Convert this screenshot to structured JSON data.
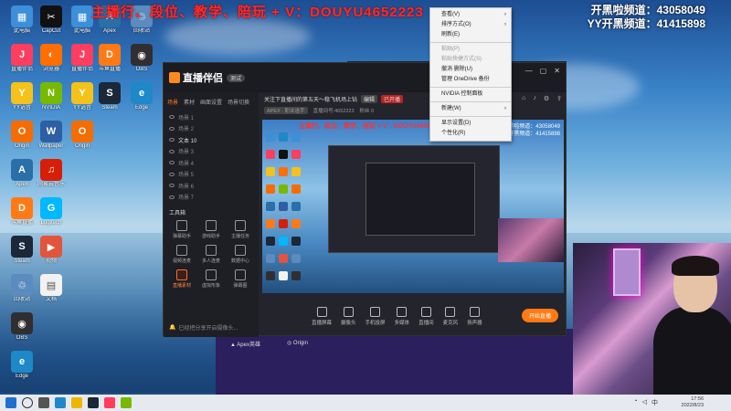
{
  "overlay": {
    "red_text": "主播行、段位、教学、陪玩 + V：DOUYU4652223",
    "line1": "开黑啦频道：43058049",
    "line2": "YY开黑频道：41415898"
  },
  "desktop_icons": [
    {
      "label": "此电脑",
      "color": "#3c8fd9",
      "glyph": "▦"
    },
    {
      "label": "直播伴侣",
      "color": "#ff3d5e",
      "glyph": "J"
    },
    {
      "label": "YY语音",
      "color": "#f4c21a",
      "glyph": "Y"
    },
    {
      "label": "Origin",
      "color": "#f56c00",
      "glyph": "O"
    },
    {
      "label": "Apex",
      "color": "#2a6fa8",
      "glyph": "A"
    },
    {
      "label": "斗鱼直播",
      "color": "#ff7a14",
      "glyph": "D"
    },
    {
      "label": "Steam",
      "color": "#1b2838",
      "glyph": "S"
    },
    {
      "label": "回收站",
      "color": "#5b8bbf",
      "glyph": "♲"
    },
    {
      "label": "OBS",
      "color": "#302e31",
      "glyph": "◉"
    },
    {
      "label": "Edge",
      "color": "#1e88c8",
      "glyph": "e"
    },
    {
      "label": "CapCut",
      "color": "#111",
      "glyph": "✂"
    },
    {
      "label": "浏览器",
      "color": "#ff6f00",
      "glyph": "◐"
    },
    {
      "label": "NVIDIA",
      "color": "#76b900",
      "glyph": "N"
    },
    {
      "label": "Wallpaper",
      "color": "#2e5fa3",
      "glyph": "W"
    },
    {
      "label": "网易云音乐",
      "color": "#d81e06",
      "glyph": "♫"
    },
    {
      "label": "Logitech",
      "color": "#00b8fc",
      "glyph": "G"
    },
    {
      "label": "视频",
      "color": "#e2543c",
      "glyph": "▶"
    },
    {
      "label": "文档",
      "color": "#f2f2f2",
      "glyph": "▤"
    }
  ],
  "context_menu": [
    {
      "label": "查看(V)",
      "arrow": true,
      "disabled": false
    },
    {
      "label": "排序方式(O)",
      "arrow": true,
      "disabled": false
    },
    {
      "label": "刷新(E)",
      "arrow": false,
      "disabled": false
    },
    {
      "sep": true
    },
    {
      "label": "粘贴(P)",
      "arrow": false,
      "disabled": true
    },
    {
      "label": "粘贴快捷方式(S)",
      "arrow": false,
      "disabled": true
    },
    {
      "label": "撤消 删除(U)",
      "arrow": false,
      "disabled": false
    },
    {
      "label": "管理 OneDrive 备份",
      "arrow": false,
      "disabled": false
    },
    {
      "sep": true
    },
    {
      "label": "NVIDIA 控制面板",
      "arrow": false,
      "disabled": false
    },
    {
      "sep": true
    },
    {
      "label": "新建(W)",
      "arrow": true,
      "disabled": false
    },
    {
      "sep": true
    },
    {
      "label": "显示设置(D)",
      "arrow": false,
      "disabled": false
    },
    {
      "label": "个性化(R)",
      "arrow": false,
      "disabled": false
    }
  ],
  "app": {
    "name": "直播伴侣",
    "version": "测试",
    "tabs": [
      "场景",
      "素材",
      "画面设置",
      "场景切换"
    ],
    "active_tab": 0,
    "scenes": [
      "场景 1",
      "场景 2",
      "文本 10",
      "场景 3",
      "场景 4",
      "场景 5",
      "场景 6",
      "场景 7"
    ],
    "selected_scene": 2,
    "tools_title": "工具箱",
    "tools": [
      "弹幕助手",
      "游戏助手",
      "主播任务",
      "视频连麦",
      "多人连麦",
      "数据中心",
      "直播素材",
      "虚拟形象",
      "弹幕图"
    ],
    "notice": "已经把分享开启摄像头...",
    "stream_title": "关注下直播间的第五天～稳飞机场上钻",
    "title_tags": [
      "编辑",
      "已开播"
    ],
    "info": [
      "APEX · 职业选手",
      "直播间号:4652223",
      "粉丝 0"
    ],
    "controls": [
      "直播屏幕",
      "摄像头",
      "手机投屏",
      "多媒体",
      "直播间",
      "麦克风",
      "扬声器"
    ],
    "start_button": "开始直播"
  },
  "taskbar": {
    "time": "17:56",
    "date": "2022/8/23"
  }
}
